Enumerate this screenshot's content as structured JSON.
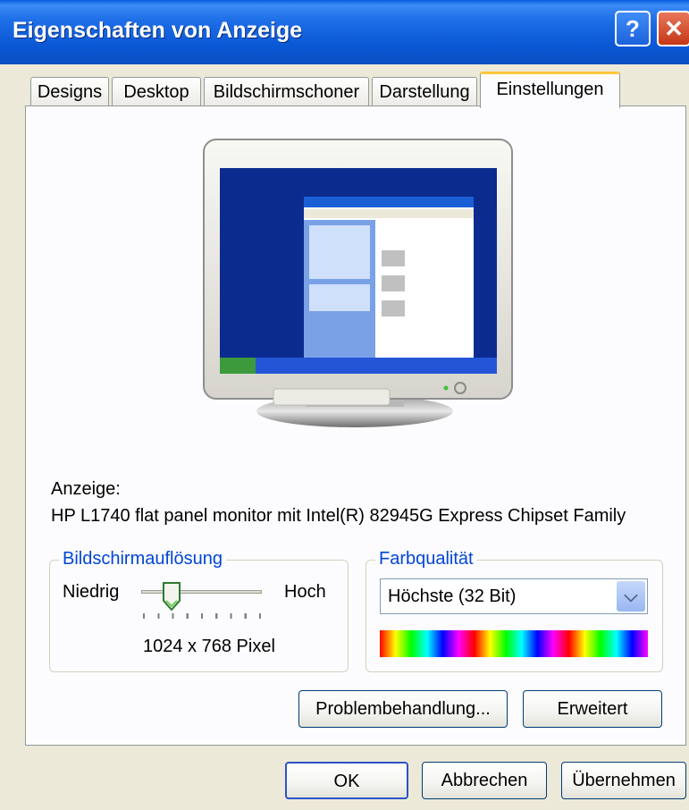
{
  "window": {
    "title": "Eigenschaften von Anzeige",
    "help_symbol": "?",
    "close_symbol": "✕"
  },
  "tabs": [
    {
      "label": "Designs"
    },
    {
      "label": "Desktop"
    },
    {
      "label": "Bildschirmschoner"
    },
    {
      "label": "Darstellung"
    },
    {
      "label": "Einstellungen",
      "active": true
    }
  ],
  "display": {
    "label": "Anzeige:",
    "device": "HP L1740 flat panel monitor mit Intel(R) 82945G Express Chipset Family"
  },
  "resolution": {
    "group_label": "Bildschirmauflösung",
    "low_label": "Niedrig",
    "high_label": "Hoch",
    "value_text": "1024 x 768 Pixel",
    "slider_position": 0.2
  },
  "color_quality": {
    "group_label": "Farbqualität",
    "selected": "Höchste (32 Bit)"
  },
  "buttons": {
    "troubleshoot": "Problembehandlung...",
    "advanced": "Erweitert",
    "ok": "OK",
    "cancel": "Abbrechen",
    "apply": "Übernehmen"
  },
  "icons": [
    "help-icon",
    "close-icon",
    "monitor-preview-icon",
    "dropdown-arrow-icon",
    "slider-thumb-icon"
  ],
  "colors": {
    "titlebar": "#0b58d6",
    "tab_accent": "#ffc83c",
    "group_legend": "#0046d5",
    "dialog_bg": "#ece9d8"
  }
}
